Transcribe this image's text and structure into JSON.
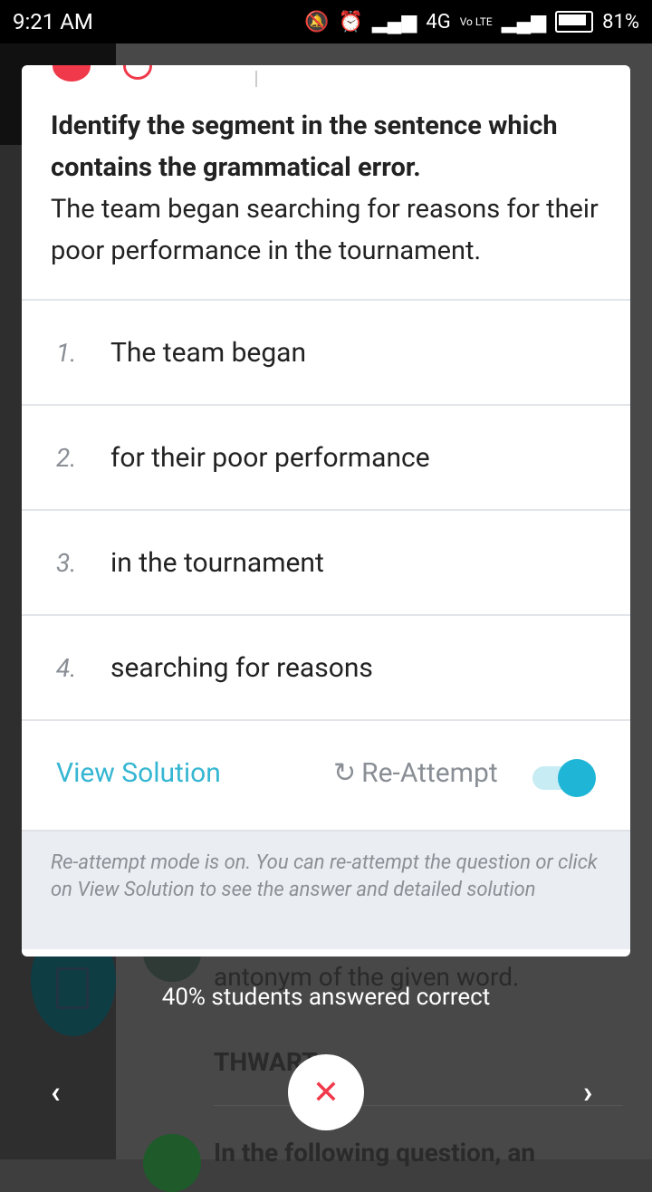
{
  "status_bar": {
    "time": "9:21 AM",
    "network": "4G",
    "volte": "Vo LTE",
    "battery": "81%"
  },
  "background": {
    "snippet1": "antonym of the given word.",
    "snippet2": "THWART",
    "snippet3": "In the following question, an"
  },
  "question": {
    "instruction": "Identify the segment in the sentence which contains the grammatical error.",
    "sentence": "The team began searching for reasons for their poor performance in the tournament."
  },
  "options": [
    {
      "num": "1.",
      "text": "The team began"
    },
    {
      "num": "2.",
      "text": "for their poor performance"
    },
    {
      "num": "3.",
      "text": "in the tournament"
    },
    {
      "num": "4.",
      "text": "searching for reasons"
    }
  ],
  "actions": {
    "view_solution": "View Solution",
    "reattempt": "Re-Attempt",
    "reattempt_on": true
  },
  "info": "Re-attempt mode is on. You can re-attempt the question or click on View Solution to see the answer and detailed solution",
  "stats": "40% students answered correct",
  "nav": {
    "prev": "‹",
    "next": "›",
    "close": "✕"
  }
}
